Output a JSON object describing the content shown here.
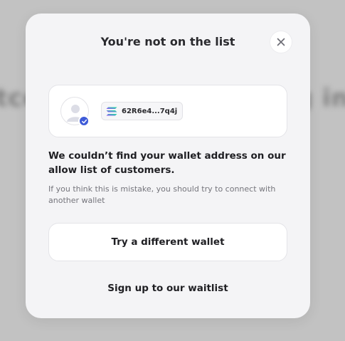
{
  "background": {
    "left_fragment": "tce",
    "right_fragment": "g in"
  },
  "modal": {
    "title": "You're not on the list",
    "close_icon": "close-icon",
    "wallet": {
      "avatar_icon": "user-avatar-icon",
      "verified_icon": "check-badge-icon",
      "chain_icon": "solana-icon",
      "address": "62R6e4...7q4j"
    },
    "message": "We couldn’t find your wallet address on our allow list of customers.",
    "hint": "If you think this is mistake, you should try to connect with another wallet",
    "try_button_label": "Try a different wallet",
    "waitlist_label": "Sign up to our waitlist"
  },
  "colors": {
    "accent": "#3e5bd8",
    "modal_bg": "#f4f4f6",
    "card_bg": "#ffffff",
    "text": "#1f1f23"
  }
}
